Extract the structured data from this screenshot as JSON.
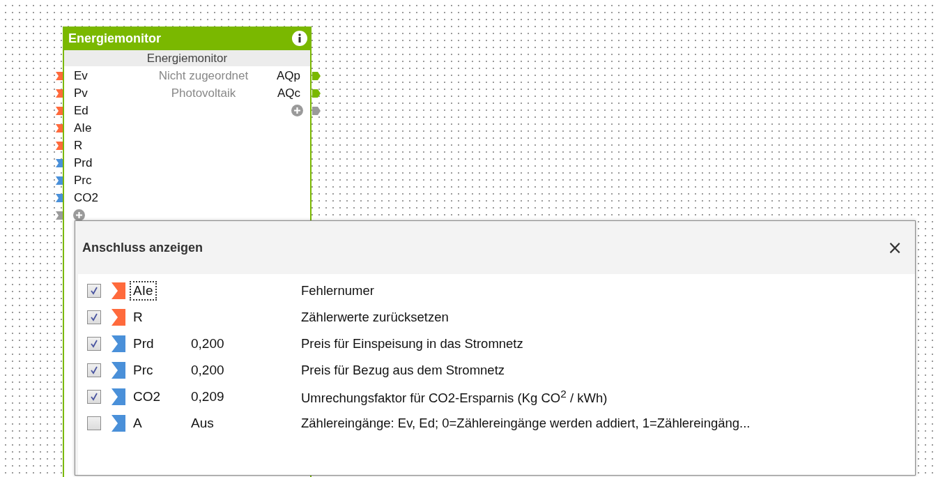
{
  "block": {
    "title": "Energiemonitor",
    "subtitle": "Energiemonitor",
    "inputs": [
      {
        "label": "Ev",
        "color": "#ff6a3c"
      },
      {
        "label": "Pv",
        "color": "#ff6a3c"
      },
      {
        "label": "Ed",
        "color": "#ff6a3c"
      },
      {
        "label": "AIe",
        "color": "#ff6a3c"
      },
      {
        "label": "R",
        "color": "#ff6a3c"
      },
      {
        "label": "Prd",
        "color": "#4a90d9"
      },
      {
        "label": "Prc",
        "color": "#4a90d9"
      },
      {
        "label": "CO2",
        "color": "#4a90d9"
      }
    ],
    "assignments": [
      "Nicht zugeordnet",
      "Photovoltaik"
    ],
    "outputs": [
      {
        "label": "AQp",
        "color": "#7ab800"
      },
      {
        "label": "AQc",
        "color": "#7ab800"
      }
    ]
  },
  "dialog": {
    "title": "Anschluss anzeigen",
    "close": "×",
    "rows": [
      {
        "checked": true,
        "focused": true,
        "color": "#ff6a3c",
        "name": "AIe",
        "value": "",
        "description": "Fehlernumer"
      },
      {
        "checked": true,
        "focused": false,
        "color": "#ff6a3c",
        "name": "R",
        "value": "",
        "description": "Zählerwerte zurücksetzen"
      },
      {
        "checked": true,
        "focused": false,
        "color": "#4a90d9",
        "name": "Prd",
        "value": "0,200",
        "description": "Preis für Einspeisung in das Stromnetz"
      },
      {
        "checked": true,
        "focused": false,
        "color": "#4a90d9",
        "name": "Prc",
        "value": "0,200",
        "description": "Preis für Bezug aus dem Stromnetz"
      },
      {
        "checked": true,
        "focused": false,
        "color": "#4a90d9",
        "name": "CO2",
        "value": "0,209",
        "description": "Umrechungsfaktor für CO2-Ersparnis (Kg CO$^{2}$ / kWh)"
      },
      {
        "checked": false,
        "focused": false,
        "color": "#4a90d9",
        "name": "A",
        "value": "Aus",
        "description": "Zählereingänge: Ev, Ed; 0=Zählereingänge werden addiert, 1=Zählereingäng..."
      }
    ]
  }
}
